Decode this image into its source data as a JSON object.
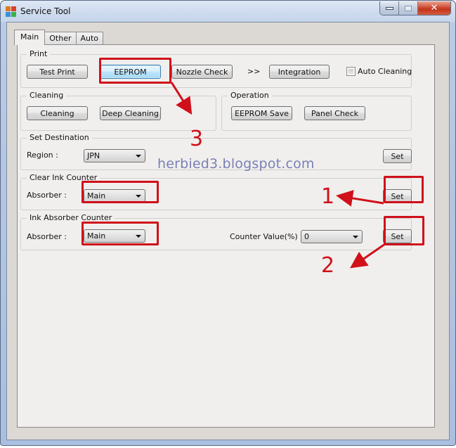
{
  "window": {
    "title": "Service Tool",
    "controls": {
      "minimize": "minimize",
      "maximize": "maximize",
      "close": "✕"
    }
  },
  "tabs": [
    {
      "label": "Main",
      "active": true
    },
    {
      "label": "Other",
      "active": false
    },
    {
      "label": "Auto",
      "active": false
    }
  ],
  "print": {
    "title": "Print",
    "test_print": "Test Print",
    "eeprom": "EEPROM",
    "nozzle_check": "Nozzle Check",
    "more": ">>",
    "integration": "Integration",
    "auto_cleaning_label": "Auto Cleaning",
    "auto_cleaning_checked": false
  },
  "cleaning": {
    "title": "Cleaning",
    "cleaning": "Cleaning",
    "deep_cleaning": "Deep Cleaning"
  },
  "operation": {
    "title": "Operation",
    "eeprom_save": "EEPROM Save",
    "panel_check": "Panel Check"
  },
  "set_destination": {
    "title": "Set Destination",
    "region_label": "Region :",
    "region_value": "JPN",
    "set": "Set"
  },
  "clear_ink_counter": {
    "title": "Clear Ink Counter",
    "absorber_label": "Absorber :",
    "absorber_value": "Main",
    "set": "Set"
  },
  "ink_absorber_counter": {
    "title": "Ink Absorber Counter",
    "absorber_label": "Absorber :",
    "absorber_value": "Main",
    "counter_label": "Counter Value(%) :",
    "counter_value": "0",
    "set": "Set"
  },
  "annotations": {
    "step1": "1",
    "step2": "2",
    "step3": "3",
    "color": "#d0101a",
    "watermark": "herbied3.blogspot.com"
  }
}
